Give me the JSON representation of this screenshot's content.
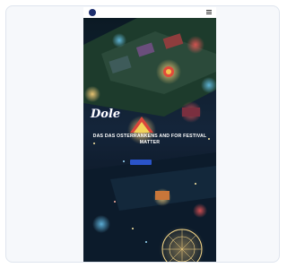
{
  "header": {
    "logo_text": "",
    "menu_icon": "hamburger-menu-icon"
  },
  "hero": {
    "brand": "Dole",
    "headline": "DAS DAS OSTERRANKENS AND FOR FESTIVAL MATTER",
    "cta_label": ""
  },
  "colors": {
    "page_bg": "#ffffff",
    "card_bg": "#f6f8fb",
    "card_border": "#dfe5ee",
    "phone_bg": "#07101c",
    "cta": "#2a54c9",
    "brand_navy": "#1d2f6e"
  }
}
